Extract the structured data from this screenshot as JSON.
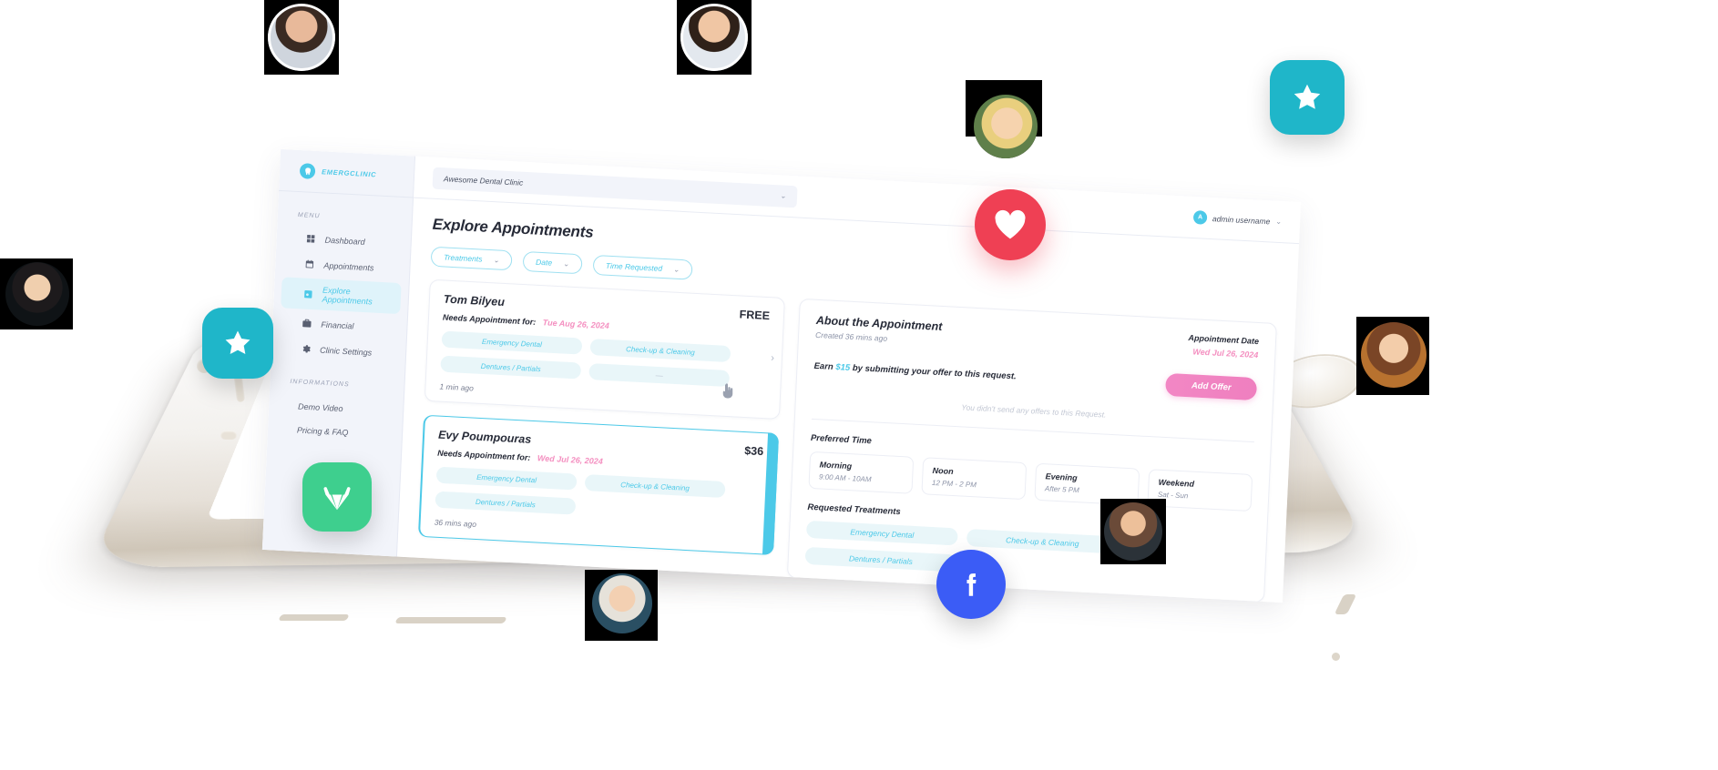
{
  "app": {
    "brand_name": "EMERGCLINIC",
    "brand_logo_icon": "tooth-logo-icon",
    "accent_color": "#4cc9e8",
    "pink_color": "#f48fc0",
    "red_color": "#ef4054"
  },
  "topbar": {
    "clinic_select_value": "Awesome Dental Clinic",
    "clinic_select_caret": "chevron-down-icon",
    "user_initial": "A",
    "user_name": "admin username",
    "user_caret": "chevron-down-icon"
  },
  "sidebar": {
    "menu_label": "MENU",
    "items": [
      {
        "label": "Dashboard",
        "icon": "dashboard-grid-icon",
        "active": false
      },
      {
        "label": "Appointments",
        "icon": "calendar-icon",
        "active": false
      },
      {
        "label": "Explore Appointments",
        "icon": "calendar-search-icon",
        "active": true
      },
      {
        "label": "Financial",
        "icon": "briefcase-dollar-icon",
        "active": false
      },
      {
        "label": "Clinic Settings",
        "icon": "gear-icon",
        "active": false
      }
    ],
    "info_label": "INFORMATIONS",
    "info_items": [
      {
        "label": "Demo Video"
      },
      {
        "label": "Pricing & FAQ"
      }
    ]
  },
  "page": {
    "title": "Explore Appointments",
    "filters": [
      {
        "label": "Treatments",
        "caret": "chevron-down-icon"
      },
      {
        "label": "Date",
        "caret": "chevron-down-icon"
      },
      {
        "label": "Time Requested",
        "caret": "chevron-down-icon"
      }
    ]
  },
  "requests": [
    {
      "name": "Tom Bilyeu",
      "price": "FREE",
      "needs_label": "Needs Appointment for:",
      "date": "Tue Aug 26, 2024",
      "tags": [
        "Emergency Dental",
        "Check-up & Cleaning",
        "Dentures / Partials",
        "—"
      ],
      "time_ago": "1 min ago",
      "selected": false,
      "chevron": "chevron-right-icon"
    },
    {
      "name": "Evy Poumpouras",
      "price": "$36",
      "needs_label": "Needs Appointment for:",
      "date": "Wed Jul 26, 2024",
      "tags": [
        "Emergency Dental",
        "Check-up & Cleaning",
        "Dentures / Partials"
      ],
      "time_ago": "36 mins ago",
      "selected": true,
      "chevron": "chevron-right-icon"
    }
  ],
  "detail": {
    "title": "About the Appointment",
    "created": "Created 36 mins ago",
    "appointment_date_label": "Appointment Date",
    "appointment_date": "Wed Jul 26, 2024",
    "earn_prefix": "Earn",
    "earn_amount": "$15",
    "earn_suffix": "by submitting your offer to this request.",
    "add_offer_label": "Add Offer",
    "empty_state": "You didn't send any offers to this Request.",
    "preferred_time_label": "Preferred Time",
    "preferred_times": [
      {
        "name": "Morning",
        "range": "9:00 AM - 10AM"
      },
      {
        "name": "Noon",
        "range": "12 PM - 2 PM"
      },
      {
        "name": "Evening",
        "range": "After 5 PM"
      },
      {
        "name": "Weekend",
        "range": "Sat - Sun"
      }
    ],
    "requested_treatments_label": "Requested Treatments",
    "requested_treatments": [
      "Emergency Dental",
      "Check-up & Cleaning",
      "Dentures / Partials"
    ]
  },
  "decor": {
    "heart_icon": "heart-icon",
    "star_badge_icon": "star-icon",
    "gitlab_badge_icon": "gitlab-fox-icon",
    "facebook_badge_icon": "facebook-f-icon",
    "cursor_icon": "hand-pointer-cursor-icon",
    "avatars": [
      "avatar-man-dark-hair",
      "avatar-man-smiling",
      "avatar-blonde-woman",
      "avatar-asian-woman",
      "avatar-brunette-woman",
      "avatar-bearded-man",
      "avatar-short-hair-woman"
    ]
  }
}
